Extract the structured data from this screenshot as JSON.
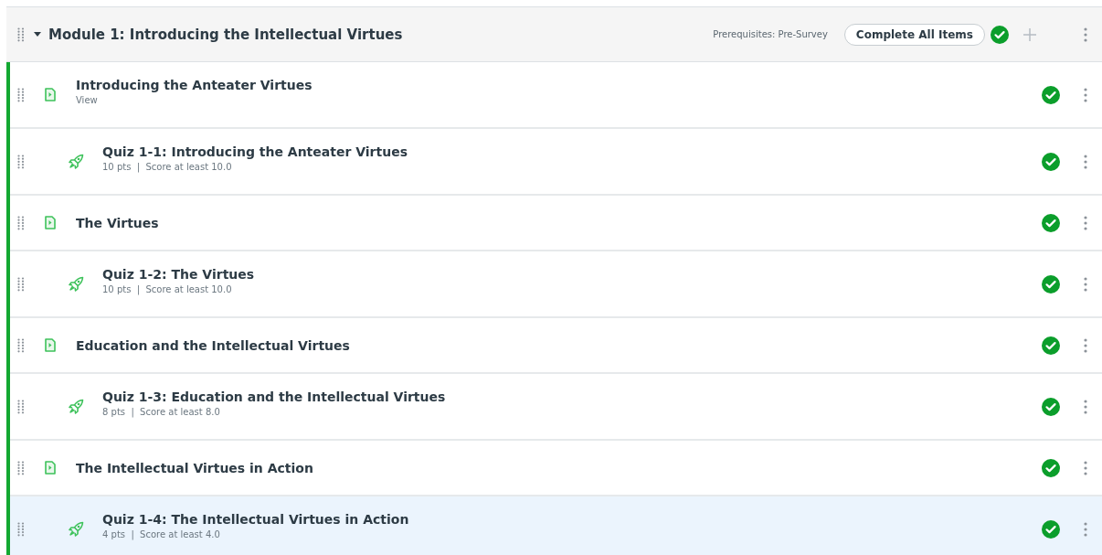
{
  "module": {
    "title": "Module 1: Introducing the Intellectual Virtues",
    "expanded": true,
    "prerequisites": "Prerequisites: Pre-Survey",
    "requirement": "Complete All Items",
    "completed": true
  },
  "items": [
    {
      "kind": "page",
      "title": "Introducing the Anteater Virtues",
      "meta": "View",
      "completed": true,
      "selected": false
    },
    {
      "kind": "quiz",
      "title": "Quiz 1-1: Introducing the Anteater Virtues",
      "meta": "10 pts  |  Score at least 10.0",
      "completed": true,
      "selected": false
    },
    {
      "kind": "page",
      "title": "The Virtues",
      "completed": true,
      "selected": false
    },
    {
      "kind": "quiz",
      "title": "Quiz 1-2: The Virtues",
      "meta": "10 pts  |  Score at least 10.0",
      "completed": true,
      "selected": false
    },
    {
      "kind": "page",
      "title": "Education and the Intellectual Virtues",
      "completed": true,
      "selected": false
    },
    {
      "kind": "quiz",
      "title": "Quiz 1-3: Education and the Intellectual Virtues",
      "meta": "8 pts  |  Score at least 8.0",
      "completed": true,
      "selected": false
    },
    {
      "kind": "page",
      "title": "The Intellectual Virtues in Action",
      "completed": true,
      "selected": false
    },
    {
      "kind": "quiz",
      "title": "Quiz 1-4: The Intellectual Virtues in Action",
      "meta": "4 pts  |  Score at least 4.0",
      "completed": true,
      "selected": true
    }
  ]
}
